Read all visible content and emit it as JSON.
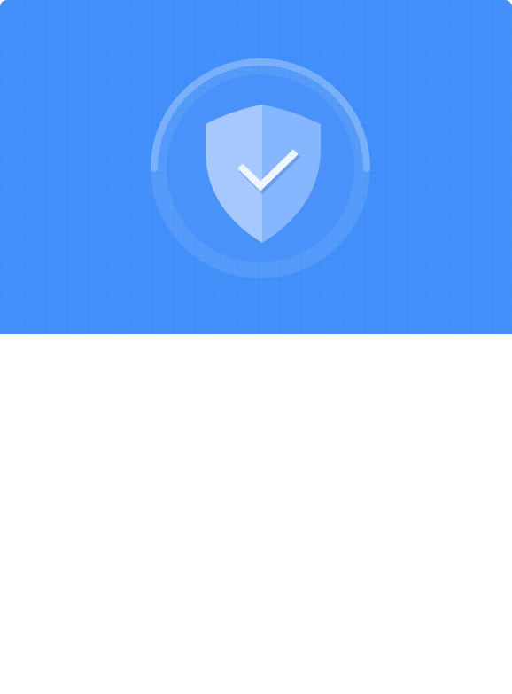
{
  "hero": {
    "background_color": "#3f8ef9",
    "ring_color": "#6aa6fb",
    "shield_light_color": "#a5c9ff",
    "shield_dark_color": "#86b6fd",
    "check_color": "#eef5ff",
    "icons": [
      "shield-check-icon",
      "progress-ring"
    ]
  }
}
